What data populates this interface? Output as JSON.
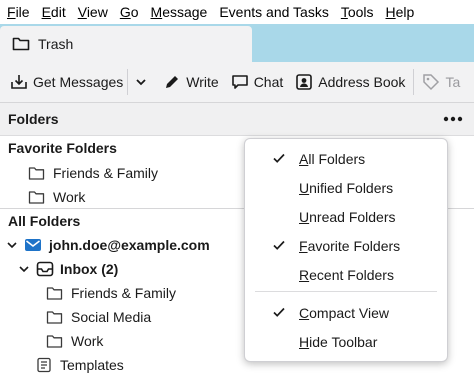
{
  "menubar": {
    "items": [
      {
        "label": "File",
        "key": "F",
        "rest": "ile"
      },
      {
        "label": "Edit",
        "key": "E",
        "rest": "dit"
      },
      {
        "label": "View",
        "key": "V",
        "rest": "iew"
      },
      {
        "label": "Go",
        "key": "G",
        "rest": "o"
      },
      {
        "label": "Message",
        "key": "M",
        "rest": "essage"
      },
      {
        "label": "Events and Tasks",
        "key": "",
        "rest": "Events and Tasks"
      },
      {
        "label": "Tools",
        "key": "T",
        "rest": "ools"
      },
      {
        "label": "Help",
        "key": "H",
        "rest": "elp"
      }
    ]
  },
  "tab": {
    "label": "Trash"
  },
  "toolbar": {
    "get_messages": "Get Messages",
    "write": "Write",
    "chat": "Chat",
    "address_book": "Address Book",
    "tag_partial": "Ta"
  },
  "folder_pane": {
    "title": "Folders",
    "favorite_header": "Favorite Folders",
    "favorites": [
      "Friends & Family",
      "Work"
    ],
    "all_header": "All Folders",
    "account": "john.doe@example.com",
    "inbox": "Inbox (2)",
    "inbox_children": [
      "Friends & Family",
      "Social Media",
      "Work"
    ],
    "templates": "Templates"
  },
  "context_menu": {
    "items": [
      {
        "key": "A",
        "rest": "ll Folders",
        "checked": true
      },
      {
        "key": "U",
        "rest": "nified Folders",
        "checked": false
      },
      {
        "key": "U",
        "rest": "nread Folders",
        "checked": false
      },
      {
        "key": "F",
        "rest": "avorite Folders",
        "checked": true
      },
      {
        "key": "R",
        "rest": "ecent Folders",
        "checked": false
      },
      {
        "key": "C",
        "rest": "ompact View",
        "checked": true
      },
      {
        "key": "H",
        "rest": "ide Toolbar",
        "checked": false
      }
    ]
  },
  "colors": {
    "tab_strip": "#a9d8e9",
    "account_icon": "#1e73c8",
    "pane_bg": "#f2f2f3"
  }
}
